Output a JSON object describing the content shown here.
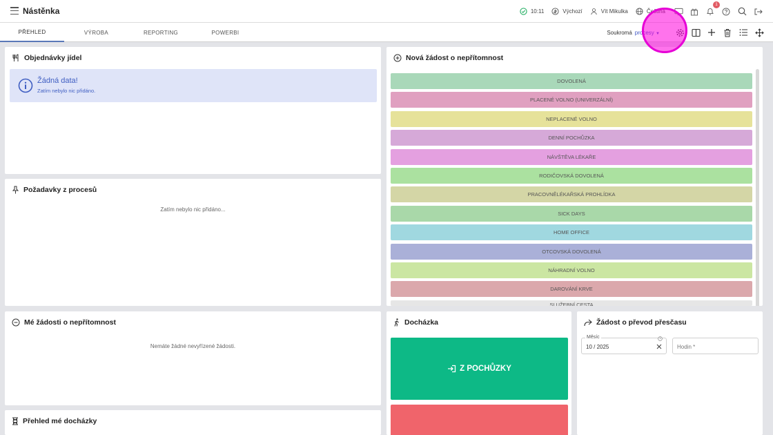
{
  "app": {
    "title": "Nástěnka"
  },
  "topbar": {
    "time": "10:11",
    "mode": "Výchozí",
    "user": "Vít Mikulka",
    "language": "Čeština",
    "notification_count": "1"
  },
  "tabs": [
    "PŘEHLED",
    "VÝROBA",
    "REPORTING",
    "POWERBI"
  ],
  "toolbar": {
    "visibility": "Soukromá",
    "scope": "procesy"
  },
  "cards": {
    "meals": {
      "title": "Objednávky jídel",
      "empty_title": "Žádná data!",
      "empty_text": "Zatím nebylo nic přidáno."
    },
    "process_requests": {
      "title": "Požadavky z procesů",
      "empty_text": "Zatím nebylo nic přidáno..."
    },
    "new_absence": {
      "title": "Nová žádost o nepřítomnost"
    },
    "my_absence": {
      "title": "Mé žádosti o nepřítomnost",
      "empty_text": "Nemáte žádné nevyřízené žádosti."
    },
    "attendance": {
      "title": "Docházka",
      "primary_button": "Z POCHŮZKY"
    },
    "overtime": {
      "title": "Žádost o převod přesčasu",
      "month_label": "Měsíc",
      "month_value": "10 / 2025",
      "hours_label": "Hodin *"
    },
    "attendance_overview": {
      "title": "Přehled mé docházky"
    }
  },
  "absence_types": [
    {
      "label": "DOVOLENÁ",
      "color": "#a9d8b9"
    },
    {
      "label": "PLACENÉ VOLNO (UNIVERZÁLNÍ)",
      "color": "#e0a0c0"
    },
    {
      "label": "NEPLACENÉ VOLNO",
      "color": "#e6e29a"
    },
    {
      "label": "DENNÍ POCHŮZKA",
      "color": "#d6a9d8"
    },
    {
      "label": "NÁVŠTĚVA LÉKAŘE",
      "color": "#e4a0e0"
    },
    {
      "label": "RODIČOVSKÁ DOVOLENÁ",
      "color": "#abe1a0"
    },
    {
      "label": "PRACOVNĚLÉKAŘSKÁ PROHLÍDKA",
      "color": "#d4d6a6"
    },
    {
      "label": "SICK DAYS",
      "color": "#a9d8a9"
    },
    {
      "label": "HOME OFFICE",
      "color": "#a0d8e0"
    },
    {
      "label": "OTCOVSKÁ DOVOLENÁ",
      "color": "#aab0d8"
    },
    {
      "label": "NÁHRADNÍ VOLNO",
      "color": "#cbe6a2"
    },
    {
      "label": "DAROVÁNÍ KRVE",
      "color": "#dba8ac"
    },
    {
      "label": "SLUŽEBNÍ CESTA",
      "color": "#e6e6e6"
    }
  ]
}
